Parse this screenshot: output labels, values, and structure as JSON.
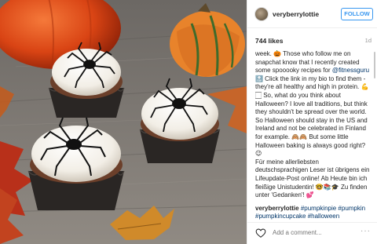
{
  "post": {
    "username": "veryberrylottie",
    "follow_label": "FOLLOW",
    "likes": "744 likes",
    "time": "1d",
    "caption": {
      "lines": [
        "week. 🎃 Those who follow me on",
        "snapchat know that I recently created",
        "some spooooky recipes for "
      ],
      "mention": "@fitnessguru",
      "rest": [
        "🔝 Click the link in my bio to find them -",
        "they're all healthy and high in protein. 💪",
        "🏻 So, what do you think about",
        "Halloween? I love all traditions, but think",
        "they shouldn't be spread over the world.",
        "So Halloween should stay in the US and",
        "Ireland and not be celebrated in Finland",
        "for example. 🙈🙈 But some little",
        "Halloween baking is always good right?",
        "😉",
        "Für meine allerliebsten",
        "deutschsprachigen Leser ist übrigens ein",
        "Lifeupdate-Post online! Ab Heute bin ich",
        "fleißige Unistudentin! 🤓📚🎓 Zu finden",
        "unter 'Gedanken'! 💕"
      ]
    },
    "hashtag_comment": {
      "user": "veryberrylottie",
      "tags": "#pumpkinpie #pumpkin #pumpkincupcake #halloween #halloweenrecipe #foodgram #foodblogging #blogging #foodblogger #foodphotography #food #fitness #fit"
    },
    "add_comment_placeholder": "Add a comment...",
    "more_label": "···"
  },
  "icons": {
    "heart": "heart-icon",
    "more": "more-options-icon",
    "avatar": "avatar"
  },
  "colors": {
    "follow_blue": "#3897f0",
    "link_blue": "#003569",
    "muted": "#999999",
    "border": "#efefef"
  }
}
